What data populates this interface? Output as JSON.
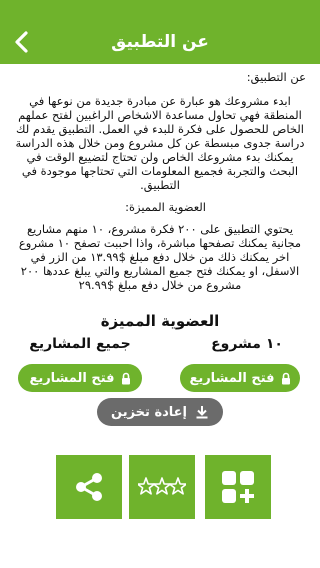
{
  "header": {
    "title": "عن التطبيق",
    "back_icon": "chevron-left-icon"
  },
  "about": {
    "heading": "عن التطبيق:",
    "body": "ابدء مشروعك هو عبارة عن مبادرة جديدة من نوعها في المنطقة فهي تحاول مساعدة الاشخاص الراغبين لفتح عملهم الخاص للحصول على فكرة للبدء في العمل. التطبيق يقدم لك دراسة جدوى مبسطة عن كل مشروع ومن خلال هذه الدراسة يمكنك بدء مشروعك الخاص ولن تحتاج لتضييع الوقت في البحث والتجربة فجميع المعلومات التي تحتاجها موجودة في التطبيق.",
    "membership_heading": "العضوية المميزة:",
    "membership_body": "يحتوي التطبيق على ٢٠٠ فكرة مشروع، ١٠ منهم مشاريع مجانية يمكنك تصفحها مباشرة، واذا احببت تصفح ١٠ مشروع اخر يمكنك ذلك من خلال دفع مبلغ ‎$١٣.٩٩‎ من الزر في الاسفل، او يمكنك فتح جميع المشاريع والتي يبلغ عددها ٢٠٠ مشروع من خلال دفع مبلغ ‎$٢٩.٩٩"
  },
  "premium": {
    "title": "العضوية المميزة",
    "plan_ten": "١٠ مشروع",
    "plan_all": "جميع المشاريع",
    "open_label": "فتح المشاريع",
    "lock_icon": "lock-icon",
    "restore_label": "إعادة تخزين",
    "restore_icon": "download-icon"
  },
  "bottom_tiles": [
    "share-icon",
    "stars-icon",
    "add-grid-icon"
  ],
  "colors": {
    "accent": "#6fb32c",
    "restore": "#6b6b6b"
  }
}
